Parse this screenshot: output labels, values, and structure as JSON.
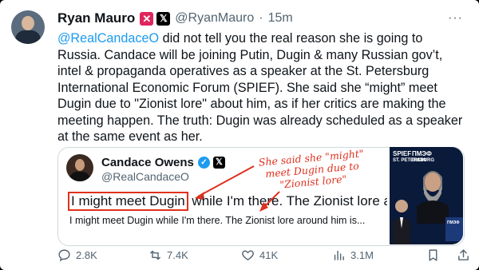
{
  "author": {
    "name": "Ryan Mauro",
    "badge": "✕",
    "platform_badge": "𝕏",
    "handle": "@RyanMauro",
    "separator": "·",
    "time": "15m",
    "more": "···"
  },
  "tweet": {
    "mention": "@RealCandaceO",
    "text": " did not tell you the real reason she is going to Russia. Candace will be joining Putin, Dugin & many Russian gov’t, intel & propaganda operatives as a speaker at the St. Petersburg International Economic Forum (SPIEF). She said she “might” meet Dugin due to \"Zionist lore\" about him, as if her critics are making the meeting happen. The truth: Dugin was already scheduled as a speaker at the same event as her."
  },
  "quote": {
    "name": "Candace Owens",
    "verified": "✓",
    "platform_badge": "𝕏",
    "handle": "@RealCandaceO",
    "big_boxed": "I might meet Dugin",
    "big_rest": " while I'm there. The Zionist lore around",
    "small_underlined": "I might meet Dugin",
    "small_rest": " while I'm there. The Zionist lore around him is..."
  },
  "annotation": {
    "line1": "She said she \"might\"",
    "line2": "meet Dugin due to",
    "line3": "\"Zionist lore\""
  },
  "image": {
    "label1": "SPIEF",
    "label2": "ПМЭФ",
    "label3": "ST. PETERSBURG",
    "label4": "ПМЭФ",
    "screen_label": "ПМЭФ"
  },
  "actions": {
    "replies": "2.8K",
    "reposts": "7.4K",
    "likes": "41K",
    "views": "3.1M"
  },
  "colors": {
    "accent": "#1d9bf0",
    "annotation": "#e0301e",
    "badge": "#e0245e"
  }
}
